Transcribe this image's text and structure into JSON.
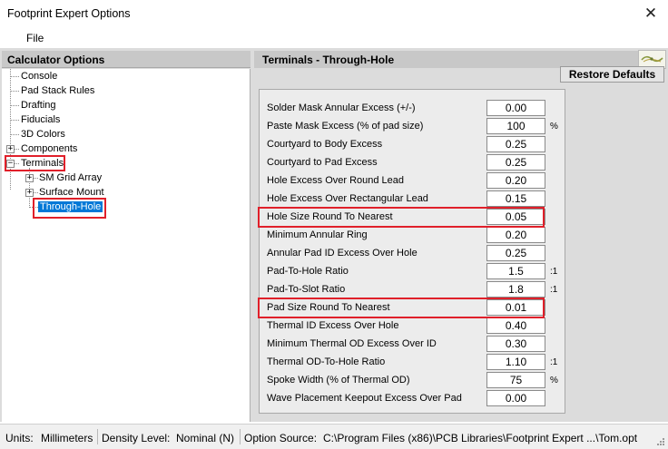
{
  "window": {
    "title": "Footprint Expert Options"
  },
  "menu": {
    "file": "File"
  },
  "left_panel": {
    "header": "Calculator Options",
    "tree": {
      "console": "Console",
      "pad_stack_rules": "Pad Stack Rules",
      "drafting": "Drafting",
      "fiducials": "Fiducials",
      "colors_3d": "3D Colors",
      "components": "Components",
      "terminals": "Terminals",
      "sm_grid_array": "SM Grid Array",
      "surface_mount": "Surface Mount",
      "through_hole": "Through-Hole"
    }
  },
  "right_panel": {
    "header": "Terminals - Through-Hole",
    "restore_label": "Restore Defaults",
    "rows": [
      {
        "label": "Solder Mask Annular Excess (+/-)",
        "value": "0.00",
        "unit": ""
      },
      {
        "label": "Paste Mask Excess (% of pad size)",
        "value": "100",
        "unit": "%"
      },
      {
        "label": "Courtyard to Body Excess",
        "value": "0.25",
        "unit": ""
      },
      {
        "label": "Courtyard to Pad Excess",
        "value": "0.25",
        "unit": ""
      },
      {
        "label": "Hole Excess Over Round Lead",
        "value": "0.20",
        "unit": ""
      },
      {
        "label": "Hole Excess Over Rectangular Lead",
        "value": "0.15",
        "unit": ""
      },
      {
        "label": "Hole Size Round To Nearest",
        "value": "0.05",
        "unit": ""
      },
      {
        "label": "Minimum Annular Ring",
        "value": "0.20",
        "unit": ""
      },
      {
        "label": "Annular Pad ID Excess Over Hole",
        "value": "0.25",
        "unit": ""
      },
      {
        "label": "Pad-To-Hole Ratio",
        "value": "1.5",
        "unit": ":1"
      },
      {
        "label": "Pad-To-Slot Ratio",
        "value": "1.8",
        "unit": ":1"
      },
      {
        "label": "Pad Size Round To Nearest",
        "value": "0.01",
        "unit": ""
      },
      {
        "label": "Thermal ID Excess Over Hole",
        "value": "0.40",
        "unit": ""
      },
      {
        "label": "Minimum Thermal OD Excess Over ID",
        "value": "0.30",
        "unit": ""
      },
      {
        "label": "Thermal OD-To-Hole Ratio",
        "value": "1.10",
        "unit": ":1"
      },
      {
        "label": "Spoke Width (% of Thermal OD)",
        "value": "75",
        "unit": "%"
      },
      {
        "label": "Wave Placement Keepout Excess Over Pad",
        "value": "0.00",
        "unit": ""
      }
    ]
  },
  "status": {
    "units_label": "Units:",
    "units_value": "Millimeters",
    "density_label": "Density Level:",
    "density_value": "Nominal (N)",
    "source_label": "Option Source:",
    "source_value": "C:\\Program Files (x86)\\PCB Libraries\\Footprint Expert ...\\Tom.opt"
  },
  "colors": {
    "highlight": "#e0202a",
    "selection": "#0078d7"
  },
  "icons": {
    "close": "close-icon",
    "logo": "pcb-libraries-logo-icon",
    "grip": "resize-grip-icon"
  }
}
